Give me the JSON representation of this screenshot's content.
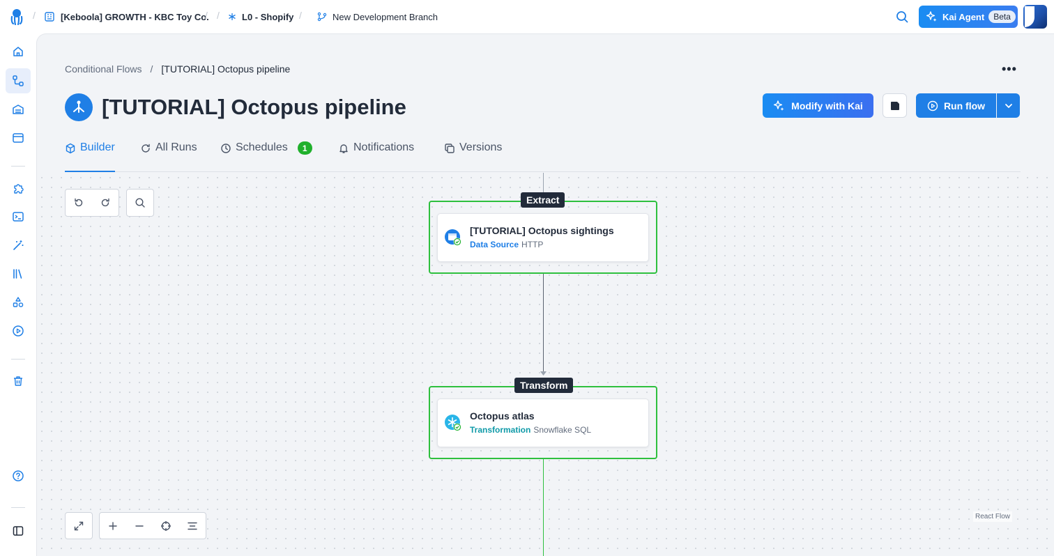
{
  "topbar": {
    "organization": "[Keboola] GROWTH - KBC Toy Co.",
    "project": "L0 - Shopify",
    "branch": "New Development Branch",
    "kai_label": "Kai Agent",
    "beta_label": "Beta"
  },
  "breadcrumb": {
    "parent": "Conditional Flows",
    "separator": "/",
    "current": "[TUTORIAL] Octopus pipeline"
  },
  "header": {
    "title": "[TUTORIAL] Octopus pipeline",
    "modify_label": "Modify with Kai",
    "run_label": "Run flow",
    "more_label": "•••"
  },
  "tabs": [
    {
      "label": "Builder",
      "active": true
    },
    {
      "label": "All Runs"
    },
    {
      "label": "Schedules",
      "badge": "1"
    },
    {
      "label": "Notifications"
    },
    {
      "label": "Versions"
    }
  ],
  "phases": [
    {
      "label": "Extract",
      "task": {
        "title": "[TUTORIAL] Octopus sightings",
        "type": "Data Source",
        "component": "HTTP",
        "type_color": "#1f7fe6"
      }
    },
    {
      "label": "Transform",
      "task": {
        "title": "Octopus atlas",
        "type": "Transformation",
        "component": "Snowflake SQL",
        "type_color": "#0f9aa8"
      }
    }
  ],
  "footer": {
    "credit": "React Flow"
  },
  "colors": {
    "accent": "#1f7fe6",
    "phase_border": "#2ec03e",
    "success": "#20b02c"
  }
}
